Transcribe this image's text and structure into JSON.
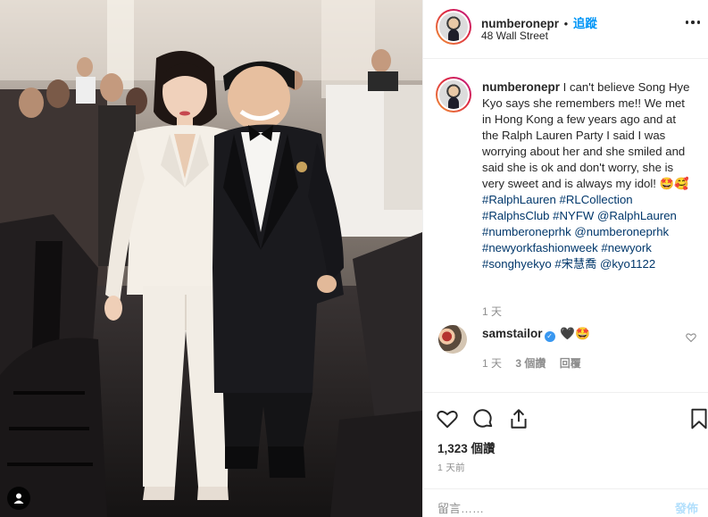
{
  "post": {
    "username": "numberonepr",
    "separator": "•",
    "follow_label": "追蹤",
    "location": "48 Wall Street"
  },
  "caption": {
    "username": "numberonepr",
    "text": " I can't believe Song Hye Kyo says she remembers me!! We met in Hong Kong a few years ago and at the Ralph Lauren Party I said I was worrying about her and she smiled and said she is ok and don't worry, she is very sweet and is always my idol! 🤩🥰 ",
    "tags": "#RalphLauren #RLCollection #RalphsClub #NYFW @RalphLauren #numberoneprhk @numberoneprhk #newyorkfashionweek #newyork #songhyekyo #宋慧喬 @kyo1122",
    "time": "1 天"
  },
  "reply": {
    "username": "samstailor",
    "verified_mark": "✓",
    "text": " 🖤🤩",
    "time": "1 天",
    "likes": "3 個讚",
    "reply_label": "回覆"
  },
  "actions": {
    "icons": [
      "heart-icon",
      "comment-icon",
      "share-icon",
      "bookmark-icon"
    ],
    "views": "1,323 個讚",
    "time": "1 天前"
  },
  "comment_box": {
    "placeholder": "留言……",
    "post_label": "發佈"
  },
  "colors": {
    "link": "#00376b",
    "follow": "#0095f6",
    "muted": "#8e8e8e",
    "border": "#efefef"
  }
}
